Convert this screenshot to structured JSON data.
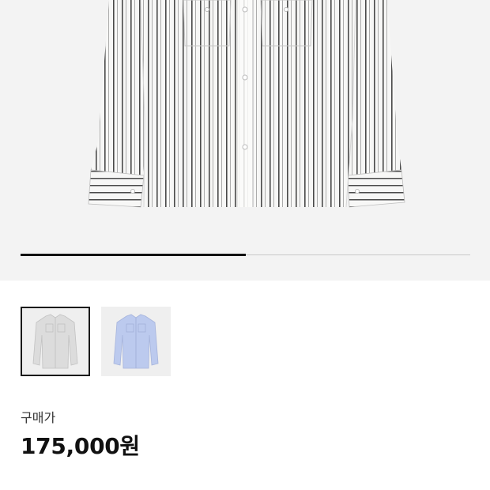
{
  "product": {
    "gallery": {
      "progress_fraction": 0.5,
      "colors": {
        "stripe": "#3a3a3a",
        "track": "#c9c9c9",
        "fill": "#111111"
      }
    },
    "color_options": [
      {
        "name": "white-gray-stripe",
        "selected": true,
        "color": "#d8d8d8"
      },
      {
        "name": "light-blue",
        "selected": false,
        "color": "#b9c6ea"
      }
    ],
    "price_label": "구매가",
    "price": "175,000원"
  }
}
